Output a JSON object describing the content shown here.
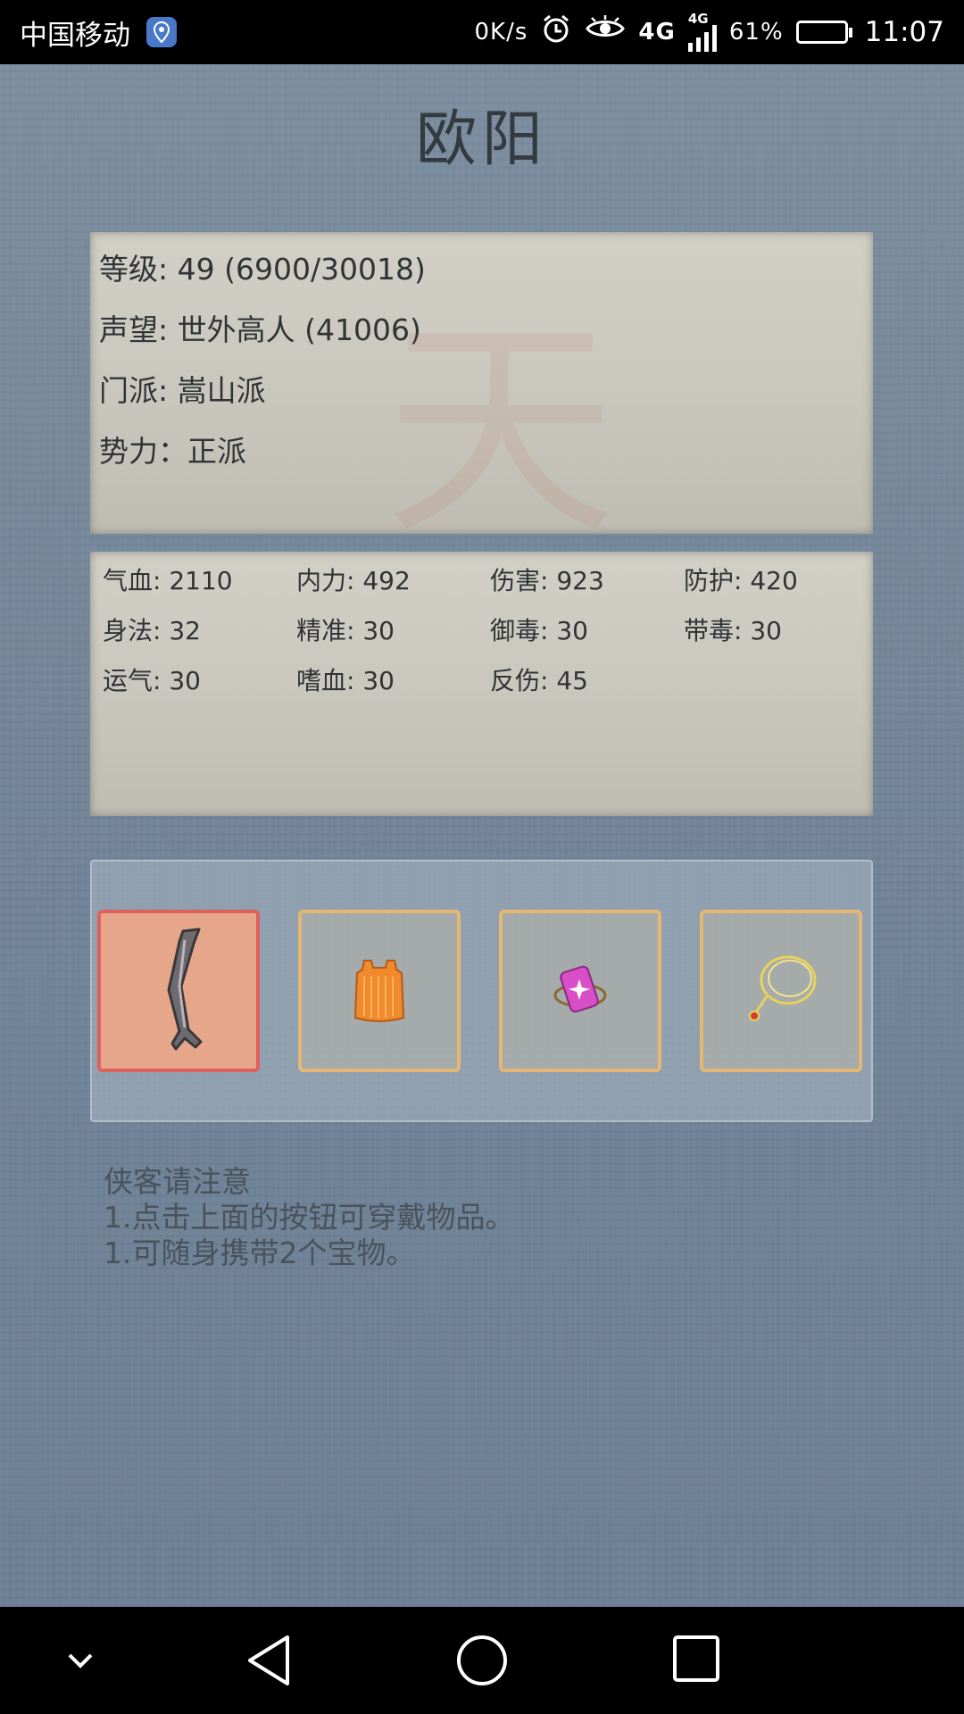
{
  "status_bar": {
    "carrier": "中国移动",
    "net_speed": "0K/s",
    "network_1": "4G",
    "network_2": "4G",
    "battery": "61%",
    "battery_level": 0.61,
    "time": "11:07"
  },
  "character": {
    "name": "欧阳",
    "info": [
      "等级: 49 (6900/30018)",
      "声望: 世外高人 (41006)",
      "门派: 嵩山派",
      "势力：正派"
    ],
    "stats": [
      "气血: 2110",
      "内力: 492",
      "伤害: 923",
      "防护: 420",
      "身法: 32",
      "精准: 30",
      "御毒: 30",
      "带毒: 30",
      "运气: 30",
      "嗜血: 30",
      "反伤: 45"
    ]
  },
  "equipment": {
    "slots": [
      {
        "icon": "sword-icon",
        "active": true
      },
      {
        "icon": "armor-icon",
        "active": false
      },
      {
        "icon": "jade-token-icon",
        "active": false
      },
      {
        "icon": "necklace-icon",
        "active": false
      }
    ]
  },
  "notes": {
    "title": "侠客请注意",
    "line1": "1.点击上面的按钮可穿戴物品。",
    "line2": "1.可随身携带2个宝物。"
  },
  "bottom_nav": [
    "building-icon",
    "character-icon",
    "map-icon",
    "skills-icon",
    "book-icon",
    "bag-icon"
  ],
  "system_nav": [
    "back-chevron-icon",
    "back-triangle-icon",
    "home-circle-icon",
    "recents-square-icon"
  ],
  "colors": {
    "background": "#6f8194",
    "panel": "#cdcbc1",
    "slot_border": "#e6b772",
    "slot_active_border": "#e0605c"
  }
}
